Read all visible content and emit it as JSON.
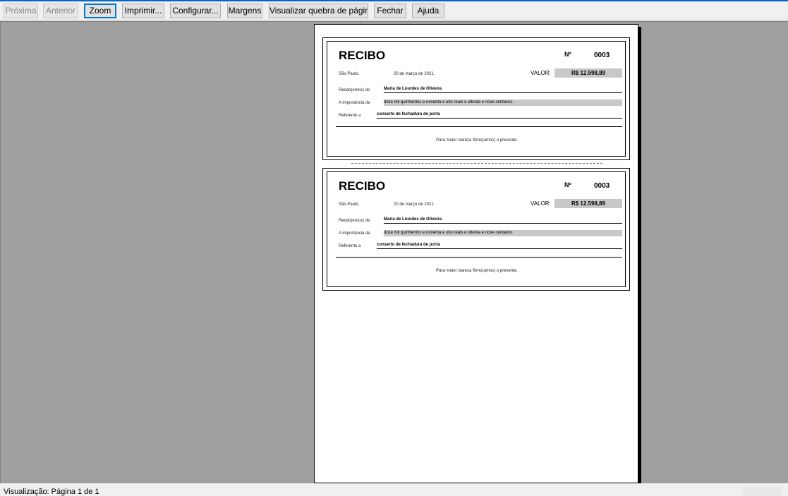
{
  "toolbar": {
    "next": "Próxima",
    "previous": "Anterior",
    "zoom": "Zoom",
    "print": "Imprimir...",
    "setup": "Configurar...",
    "margins": "Margens",
    "page_break": "Visualizar quebra de página",
    "close": "Fechar",
    "help": "Ajuda"
  },
  "receipts": [
    {
      "title": "RECIBO",
      "number_label": "Nº",
      "number": "0003",
      "city": "São Paulo,",
      "date": "20 de março de 2021.",
      "value_label": "VALOR:",
      "value": "R$ 12.598,89",
      "received_label": "Receb(emos) de",
      "received_from": "Maria de Lourdes de Oliveira",
      "amount_label": "A importância de",
      "amount_words": "doze mil quinhentos e noventa e oito reais e oitenta e nove centavos",
      "reference_label": "Referente a",
      "reference": "conserto de fechadura de porta",
      "footer": "Para maior clareza firmo(amos) o presente."
    },
    {
      "title": "RECIBO",
      "number_label": "Nº",
      "number": "0003",
      "city": "São Paulo,",
      "date": "20 de março de 2021.",
      "value_label": "VALOR:",
      "value": "R$ 12.598,89",
      "received_label": "Receb(emos) de",
      "received_from": "Maria de Lourdes de Oliveira",
      "amount_label": "A importância de",
      "amount_words": "doze mil quinhentos e noventa e oito reais e oitenta e nove centavos",
      "reference_label": "Referente a",
      "reference": "conserto de fechadura de porta",
      "footer": "Para maior clareza firmo(amos) o presente."
    }
  ],
  "status": {
    "text": "Visualização: Página 1 de 1"
  }
}
